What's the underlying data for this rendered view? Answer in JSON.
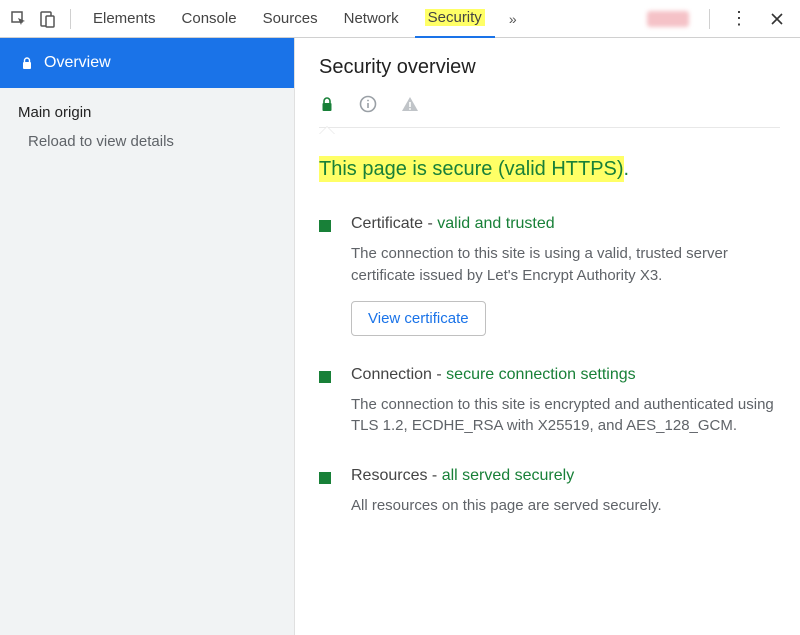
{
  "toolbar": {
    "tabs": {
      "elements": "Elements",
      "console": "Console",
      "sources": "Sources",
      "network": "Network",
      "security": "Security"
    },
    "more": "»"
  },
  "sidebar": {
    "overview": "Overview",
    "main_origin": "Main origin",
    "reload_hint": "Reload to view details"
  },
  "main": {
    "heading": "Security overview",
    "status_hl": "This page is secure (valid HTTPS)",
    "status_tail": ".",
    "cert": {
      "label": "Certificate - ",
      "status": "valid and trusted",
      "desc": "The connection to this site is using a valid, trusted server certificate issued by Let's Encrypt Authority X3.",
      "button": "View certificate"
    },
    "conn": {
      "label": "Connection - ",
      "status": "secure connection settings",
      "desc": "The connection to this site is encrypted and authenticated using TLS 1.2, ECDHE_RSA with X25519, and AES_128_GCM."
    },
    "res": {
      "label": "Resources - ",
      "status": "all served securely",
      "desc": "All resources on this page are served securely."
    }
  }
}
